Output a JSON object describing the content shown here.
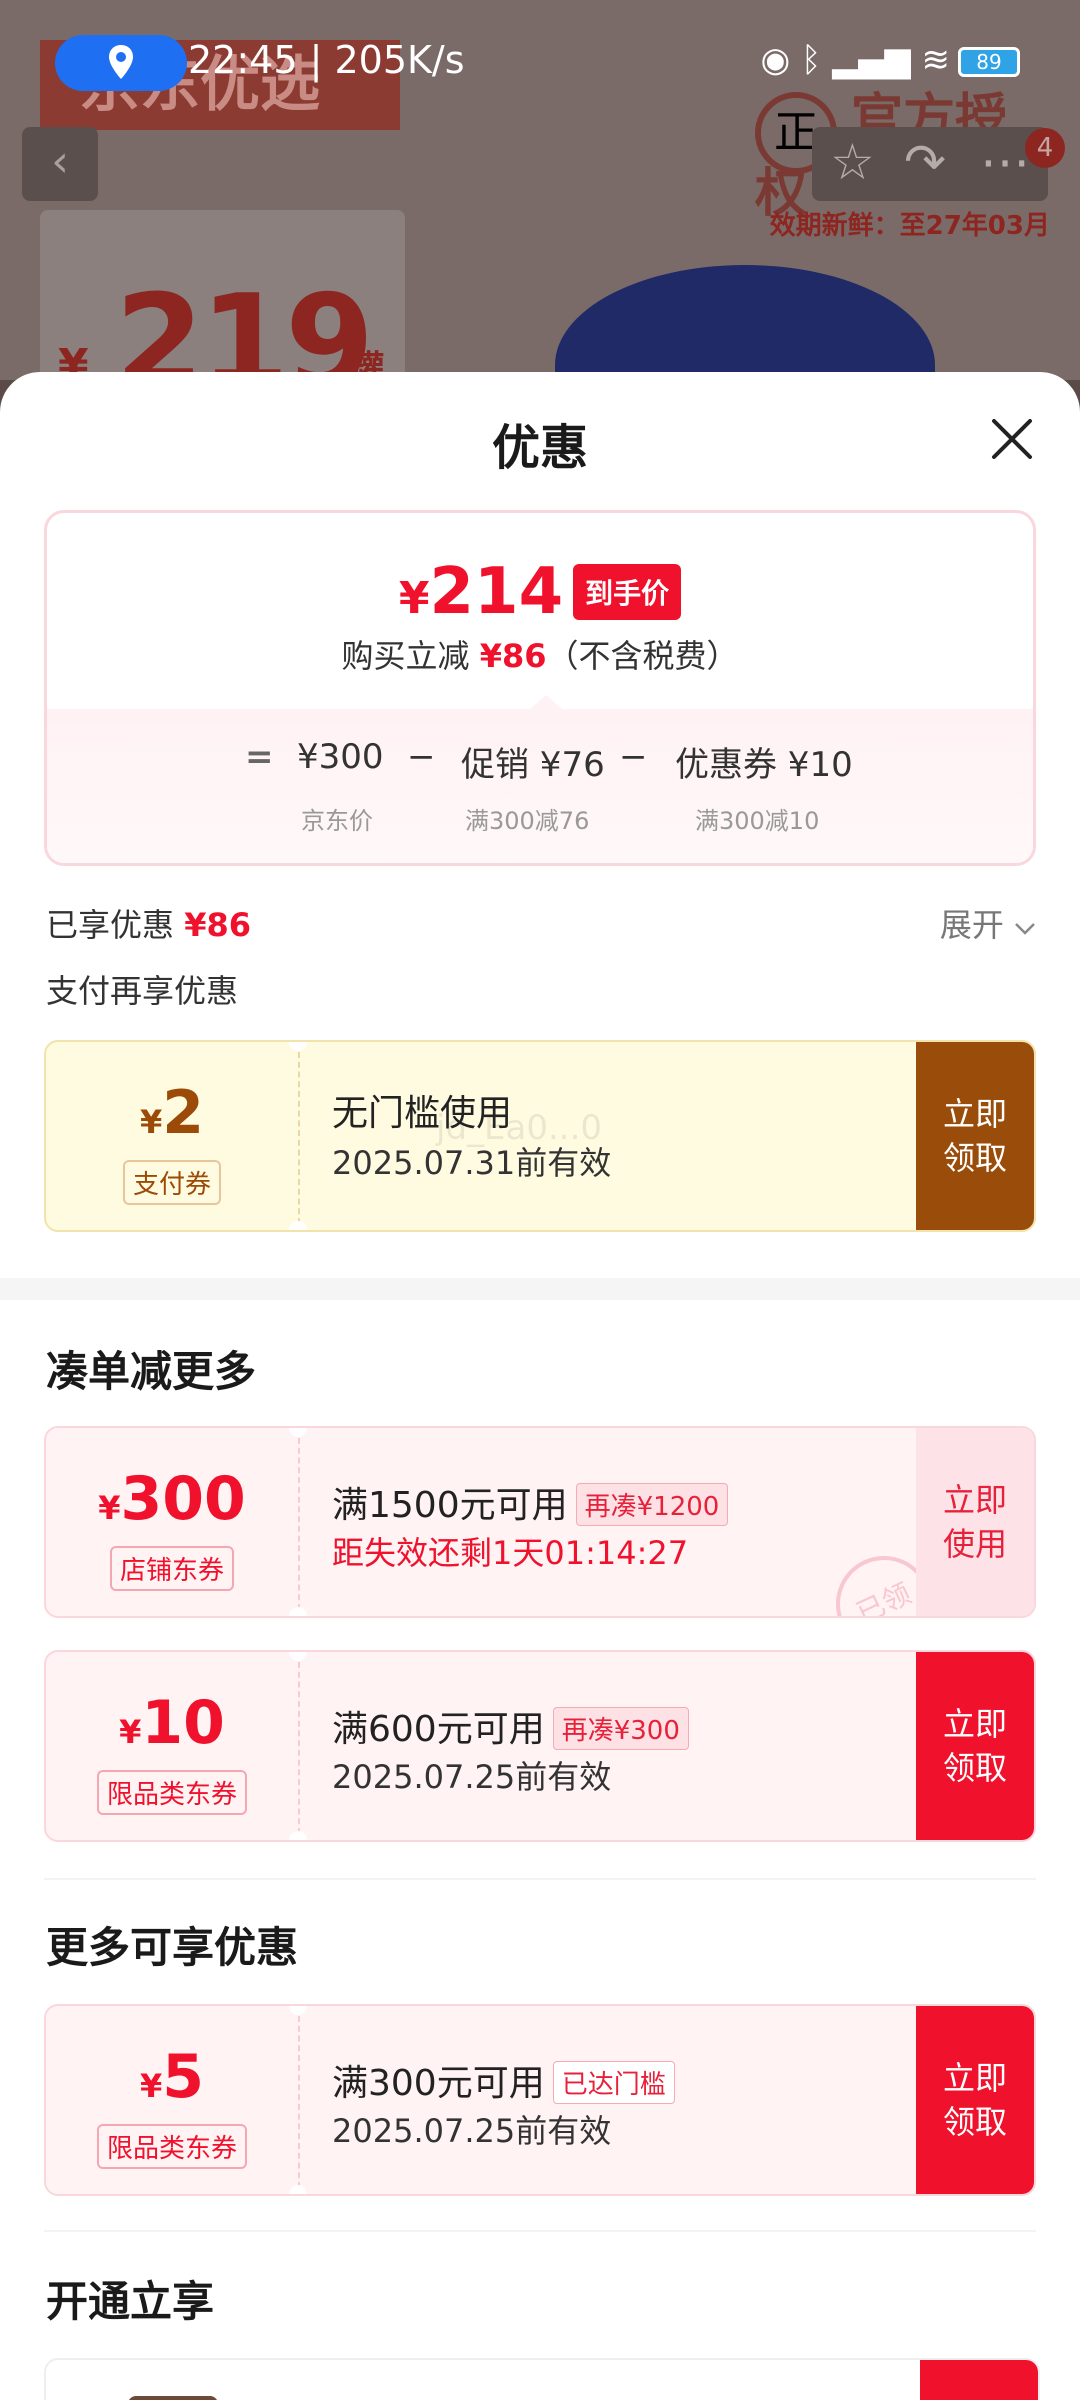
{
  "status_bar": {
    "time": "22:45 | 205K/s",
    "battery": "89"
  },
  "background": {
    "brand": "京东优选",
    "price_yen": "¥",
    "price": "219",
    "price_unit": "/罐",
    "authorized": "官方授权",
    "authorized_circle": "正",
    "expiry": "效期新鲜：至27年03月",
    "cart_badge": "4"
  },
  "sheet": {
    "title": "优惠",
    "summary": {
      "final_price_yen": "¥",
      "final_price": "214",
      "final_tag": "到手价",
      "saved_prefix": "购买立减",
      "saved_amount": "¥86",
      "saved_suffix": "（不含税费）",
      "eq": "=",
      "jd_price": "¥300",
      "minus1": "−",
      "promo": "促销 ¥76",
      "minus2": "−",
      "coupon": "优惠券 ¥10",
      "jd_price_label": "京东价",
      "promo_label": "满300减76",
      "coupon_label": "满300减10"
    },
    "enjoyed_label": "已享优惠",
    "enjoyed_amount": "¥86",
    "expand_label": "展开",
    "pay_more_label": "支付再享优惠",
    "pay_coupon": {
      "yen": "¥",
      "amount": "2",
      "type": "支付券",
      "condition": "无门槛使用",
      "valid": "2025.07.31前有效",
      "watermark": "jd_Ea0...0",
      "action_line1": "立即",
      "action_line2": "领取"
    },
    "section_more": "凑单减更多",
    "coupon_store": {
      "yen": "¥",
      "amount": "300",
      "type": "店铺东券",
      "condition": "满1500元可用",
      "tag": "再凑¥1200",
      "valid": "距失效还剩1天01:14:27",
      "stamp": "已领",
      "action_line1": "立即",
      "action_line2": "使用"
    },
    "coupon_category1": {
      "yen": "¥",
      "amount": "10",
      "type": "限品类东券",
      "condition": "满600元可用",
      "tag": "再凑¥300",
      "valid": "2025.07.25前有效",
      "action_line1": "立即",
      "action_line2": "领取"
    },
    "section_enjoy": "更多可享优惠",
    "coupon_category2": {
      "yen": "¥",
      "amount": "5",
      "type": "限品类东券",
      "condition": "满300元可用",
      "tag": "已达门槛",
      "valid": "2025.07.25前有效",
      "action_line1": "立即",
      "action_line2": "领取"
    },
    "section_open": "开通立享"
  }
}
